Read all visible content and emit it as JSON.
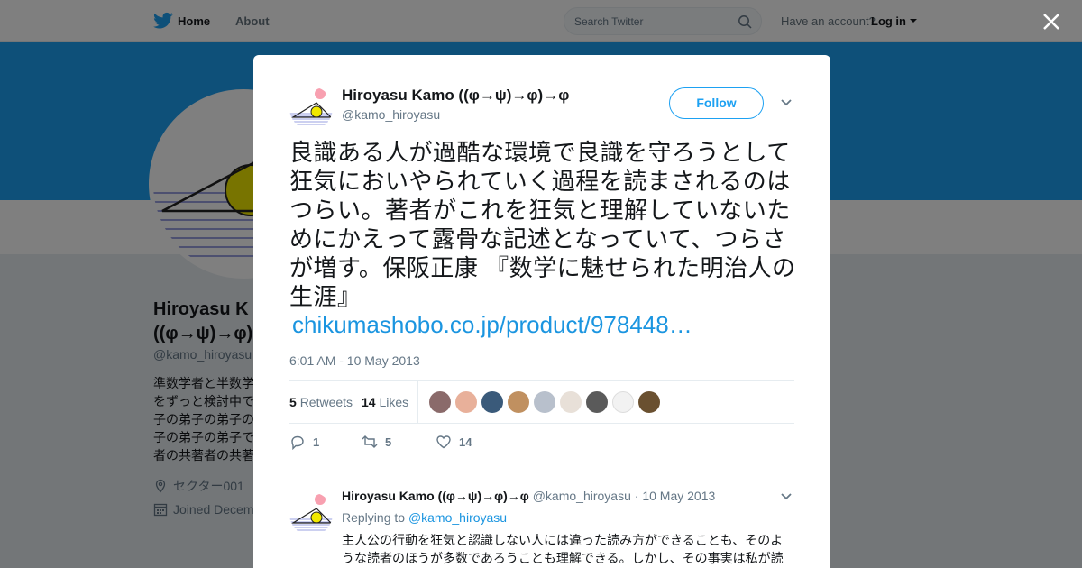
{
  "nav": {
    "home_label": "Home",
    "about_label": "About",
    "search_placeholder": "Search Twitter",
    "have_account": "Have an account?",
    "login_label": "Log in"
  },
  "profile": {
    "name_line1": "Hiroyasu K",
    "name_line2": "((φ→ψ)→φ)",
    "handle": "@kamo_hiroyasu",
    "bio_lines": [
      "準数学者と半数学",
      "をずっと検討中で",
      "子の弟子の弟子の",
      "子の弟子の弟子で",
      "者の共著者の共著"
    ],
    "location": "セクター001",
    "joined": "Joined Decem"
  },
  "tweet": {
    "author_name": "Hiroyasu Kamo ((φ→ψ)→φ)→φ",
    "author_handle": "@kamo_hiroyasu",
    "follow_label": "Follow",
    "text": "良識ある人が過酷な環境で良識を守ろうとして狂気においやられていく過程を読まされるのはつらい。著者がこれを狂気と理解していないためにかえって露骨な記述となっていて、つらさが増す。保阪正康 『数学に魅せられた明治人の生涯』",
    "link": "chikumashobo.co.jp/product/978448…",
    "timestamp": "6:01 AM - 10 May 2013",
    "retweets_count": "5",
    "retweets_label": "Retweets",
    "likes_count": "14",
    "likes_label": "Likes",
    "reply_count": "1",
    "retweet_action_count": "5",
    "like_action_count": "14"
  },
  "reply": {
    "author_name": "Hiroyasu Kamo ((φ→ψ)→φ)→φ",
    "author_handle": "@kamo_hiroyasu",
    "date": "10 May 2013",
    "replying_prefix": "Replying to",
    "replying_to": "@kamo_hiroyasu",
    "text": "主人公の行動を狂気と認識しない人には違った読み方ができることも、そのような読者のほうが多数であろうことも理解できる。しかし、その事実は私が読"
  },
  "colors": {
    "accent": "#1da1f2",
    "link": "#1b95e0",
    "secondary_text": "#657786"
  }
}
